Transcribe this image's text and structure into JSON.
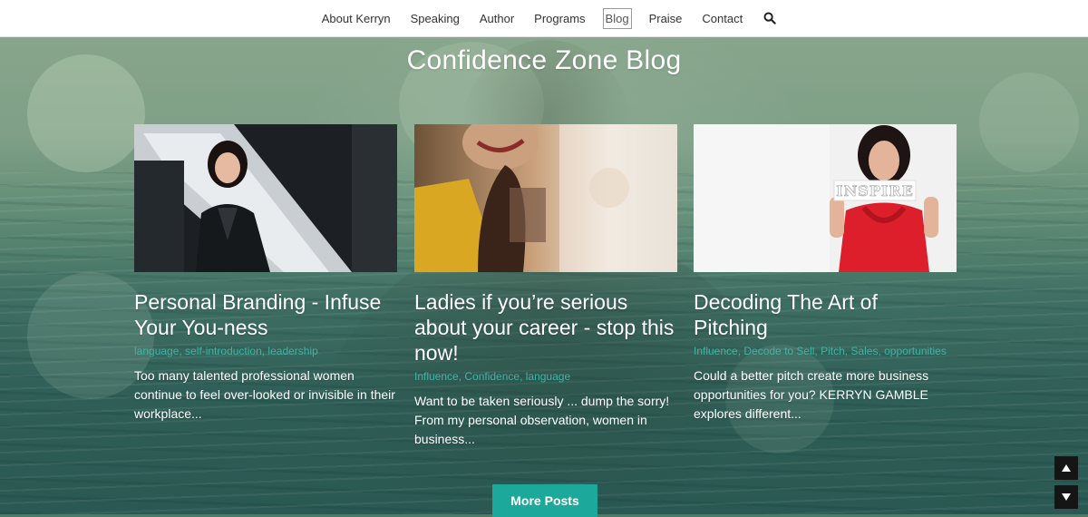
{
  "nav": {
    "items": [
      {
        "label": "About Kerryn",
        "active": false
      },
      {
        "label": "Speaking",
        "active": false
      },
      {
        "label": "Author",
        "active": false
      },
      {
        "label": "Programs",
        "active": false
      },
      {
        "label": "Blog",
        "active": true
      },
      {
        "label": "Praise",
        "active": false
      },
      {
        "label": "Contact",
        "active": false
      }
    ],
    "search_icon": "search-icon"
  },
  "page": {
    "title": "Confidence Zone Blog"
  },
  "posts": [
    {
      "title": "Personal Branding - Infuse Your You-ness",
      "tags": "language, self-introduction, leadership",
      "excerpt": "Too many talented professional women continue to feel over-looked or invisible in their workplace..."
    },
    {
      "title": "Ladies if you’re serious about your career - stop this now!",
      "tags": "Influence, Confidence, language",
      "excerpt": "Want to be taken seriously ... dump the sorry! From my personal observation, women in business..."
    },
    {
      "title": "Decoding The Art of Pitching",
      "tags": "Influence, Decode to Sell, Pitch, Sales, opportunities",
      "excerpt": "Could a better pitch create more business opportunities for you? KERRYN GAMBLE explores different..."
    }
  ],
  "more_posts": {
    "label": "More Posts"
  },
  "scroll": {
    "up_icon": "arrow-up-icon",
    "down_icon": "arrow-down-icon"
  },
  "colors": {
    "accent": "#1ca99c",
    "tag": "#3fb3a6",
    "nav_bg": "#ffffff"
  }
}
